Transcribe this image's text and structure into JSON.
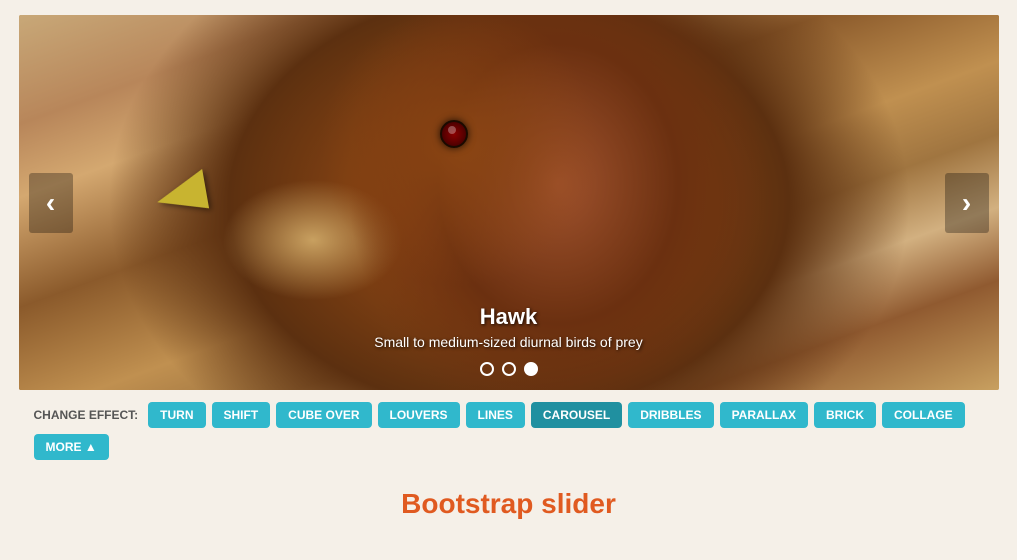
{
  "carousel": {
    "title": "Hawk",
    "subtitle": "Small to medium-sized diurnal birds of prey",
    "prev_label": "‹",
    "next_label": "›",
    "indicators": [
      {
        "id": 0,
        "active": false
      },
      {
        "id": 1,
        "active": false
      },
      {
        "id": 2,
        "active": true
      }
    ]
  },
  "effects": {
    "label": "CHANGE EFFECT:",
    "buttons": [
      {
        "id": "turn",
        "label": "TURN",
        "active": false
      },
      {
        "id": "shift",
        "label": "SHIFT",
        "active": false
      },
      {
        "id": "cubeover",
        "label": "CUBE OVER",
        "active": false
      },
      {
        "id": "louvers",
        "label": "LOUVERS",
        "active": false
      },
      {
        "id": "lines",
        "label": "LINES",
        "active": false
      },
      {
        "id": "carousel",
        "label": "CAROUSEL",
        "active": true
      },
      {
        "id": "dribbles",
        "label": "DRIBBLES",
        "active": false
      },
      {
        "id": "parallax",
        "label": "PARALLAX",
        "active": false
      },
      {
        "id": "brick",
        "label": "BRICK",
        "active": false
      },
      {
        "id": "collage",
        "label": "COLLAGE",
        "active": false
      },
      {
        "id": "more",
        "label": "MORE ▲",
        "active": false
      }
    ]
  },
  "page_title": "Bootstrap slider"
}
